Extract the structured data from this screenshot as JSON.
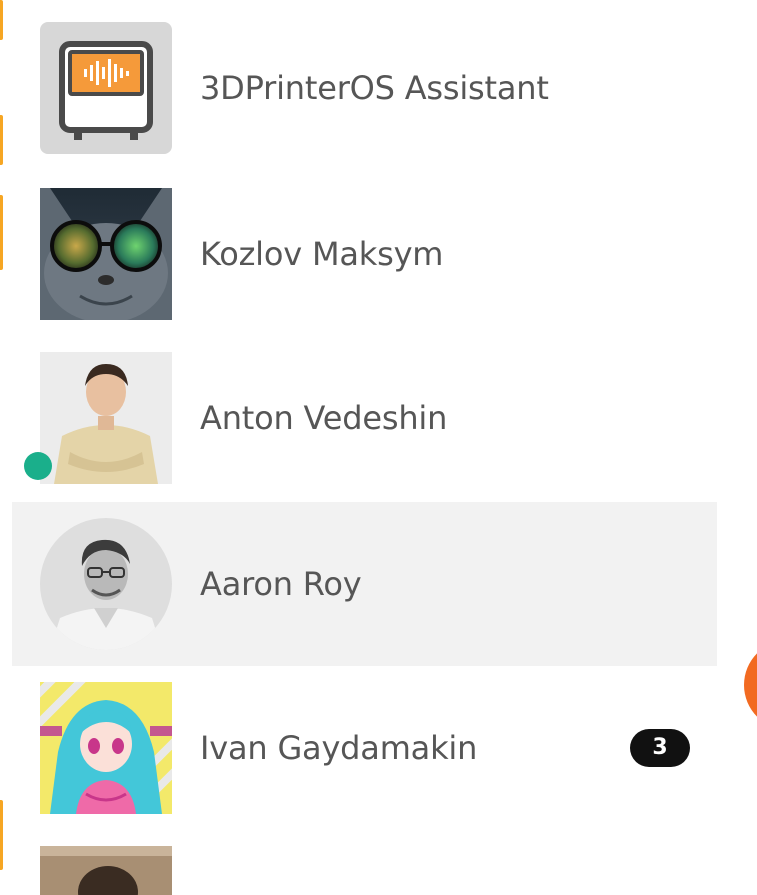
{
  "contacts": [
    {
      "name": "3DPrinterOS Assistant",
      "avatar_icon": "printer-assistant-icon",
      "online": false,
      "selected": false,
      "unread": ""
    },
    {
      "name": "Kozlov Maksym",
      "avatar_icon": "cat-sunglasses-photo",
      "online": false,
      "selected": false,
      "unread": ""
    },
    {
      "name": "Anton Vedeshin",
      "avatar_icon": "person-photo",
      "online": true,
      "selected": false,
      "unread": ""
    },
    {
      "name": "Aaron Roy",
      "avatar_icon": "person-bw-photo",
      "online": false,
      "selected": true,
      "unread": ""
    },
    {
      "name": "Ivan Gaydamakin",
      "avatar_icon": "anime-girl-photo",
      "online": false,
      "selected": false,
      "unread": "3"
    }
  ],
  "colors": {
    "accent": "#f6a623",
    "online": "#1aaf8b",
    "badge": "#111111",
    "selected_row": "#f2f2f2",
    "fab": "#f26a21",
    "name_text": "#565656"
  }
}
